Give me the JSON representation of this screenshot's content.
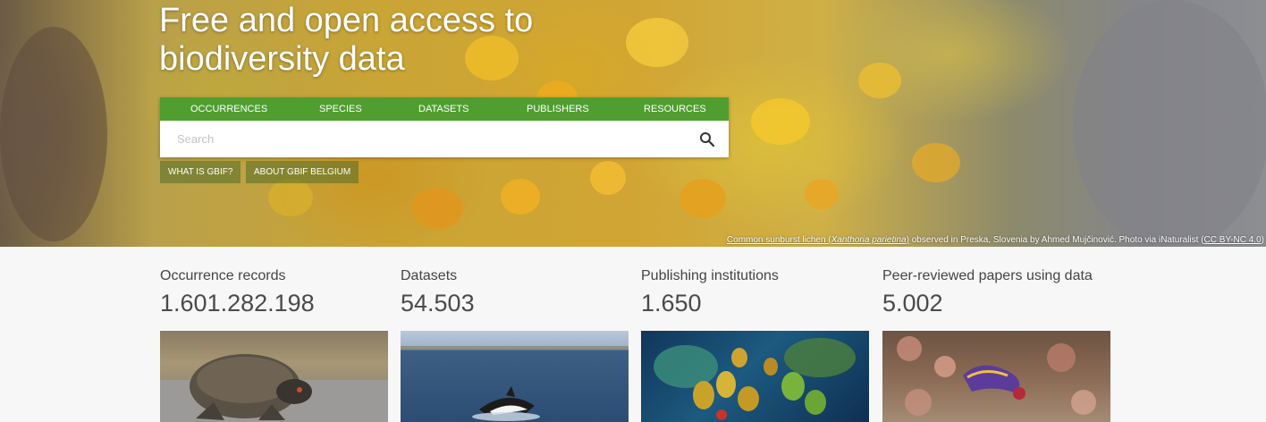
{
  "hero": {
    "title": "Free and open access to biodiversity data",
    "search_tabs": [
      "OCCURRENCES",
      "SPECIES",
      "DATASETS",
      "PUBLISHERS",
      "RESOURCES"
    ],
    "search_placeholder": "Search",
    "buttons": [
      "WHAT IS GBIF?",
      "ABOUT GBIF BELGIUM"
    ],
    "caption": {
      "link1": "Common sunburst lichen (",
      "species": "Xanthoria parietina",
      "link1_end": ")",
      "middle": " observed in Preska, Slovenia by Ahmed Mujčinović. Photo via iNaturalist (",
      "license": "CC BY-NC 4.0",
      "end": ")"
    }
  },
  "stats": [
    {
      "label": "Occurrence records",
      "value": "1.601.282.198"
    },
    {
      "label": "Datasets",
      "value": "54.503"
    },
    {
      "label": "Publishing institutions",
      "value": "1.650"
    },
    {
      "label": "Peer-reviewed papers using data",
      "value": "5.002"
    }
  ],
  "cards": [
    {
      "icon": "turtle-photo"
    },
    {
      "icon": "dolphin-photo"
    },
    {
      "icon": "coral-reef-photo"
    },
    {
      "icon": "nudibranch-photo"
    }
  ],
  "colors": {
    "brand_green": "#509e2f",
    "page_bg": "#f7f7f7"
  }
}
